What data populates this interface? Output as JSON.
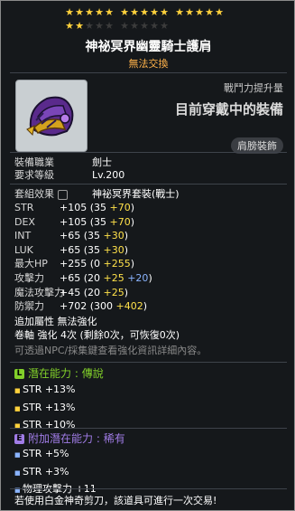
{
  "stars": {
    "row1_filled": 15,
    "row2_filled": 2,
    "row2_total": 10
  },
  "item": {
    "name": "神祕冥界幽靈騎士護肩",
    "trade_status": "無法交換",
    "icon": "helmet-shoulder-icon",
    "power_label": "戰鬥力提升量",
    "equipped_text": "目前穿戴中的裝備",
    "slot_badge": "肩膀裝飾"
  },
  "requirements": {
    "job_label": "裝備職業",
    "job_value": "劍士",
    "level_label": "要求等級",
    "level_value": "Lv.200"
  },
  "set_effect": {
    "label": "套組效果",
    "value": "神祕冥界套裝(戰士)"
  },
  "stats": [
    {
      "name": "STR",
      "total": "+105",
      "base": "35",
      "bonus": "+70",
      "bonus_color": "yellow"
    },
    {
      "name": "DEX",
      "total": "+105",
      "base": "35",
      "bonus": "+70",
      "bonus_color": "yellow"
    },
    {
      "name": "INT",
      "total": "+65",
      "base": "35",
      "bonus": "+30",
      "bonus_color": "yellow"
    },
    {
      "name": "LUK",
      "total": "+65",
      "base": "35",
      "bonus": "+30",
      "bonus_color": "yellow"
    },
    {
      "name": "最大HP",
      "total": "+255",
      "base": "0",
      "bonus": "+255",
      "bonus_color": "yellow"
    },
    {
      "name": "攻擊力",
      "total": "+65",
      "base": "20",
      "bonus": "+25",
      "bonus2": "+20",
      "bonus_color": "yellow"
    },
    {
      "name": "魔法攻擊力",
      "total": "+45",
      "base": "20",
      "bonus": "+25",
      "bonus_color": "yellow"
    },
    {
      "name": "防禦力",
      "total": "+702",
      "base": "300",
      "bonus": "+402",
      "bonus_color": "yellow"
    }
  ],
  "extra": {
    "attr_label": "追加屬性",
    "attr_value": "無法強化",
    "scroll_label": "卷軸",
    "scroll_value": "強化 4次 (剩餘0次，可恢復0次)",
    "system_note": "可透過NPC/採集鍵查看強化資訊詳細內容。"
  },
  "potential": {
    "badge": "L",
    "label": "潛在能力",
    "grade": "傳說",
    "lines": [
      "STR +13%",
      "STR +13%",
      "STR +10%"
    ]
  },
  "additional_potential": {
    "badge": "E",
    "label": "附加潛在能力",
    "grade": "稀有",
    "lines": [
      "STR +5%",
      "STR +3%",
      "物理攻擊力 +11"
    ]
  },
  "footer_note": "若使用白金神奇剪刀，該道具可進行一次交易!",
  "colors": {
    "star": "#ffd23c",
    "legend": "#82d02a",
    "epic": "#a07ce6",
    "yellow": "#ffe14a",
    "green": "#5cf05c",
    "blue": "#8ab4ff"
  }
}
